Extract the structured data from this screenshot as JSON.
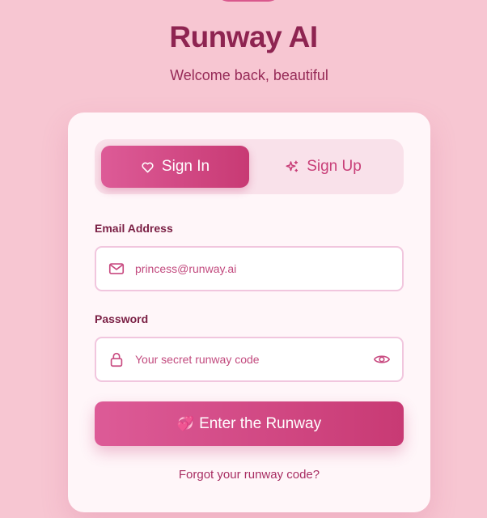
{
  "app": {
    "title": "Runway AI",
    "subtitle": "Welcome back, beautiful"
  },
  "tabs": [
    {
      "label": "Sign In",
      "icon": "heart-icon",
      "active": true
    },
    {
      "label": "Sign Up",
      "icon": "sparkle-icon",
      "active": false
    }
  ],
  "form": {
    "email": {
      "label": "Email Address",
      "placeholder": "princess@runway.ai",
      "value": "",
      "icon": "mail-icon"
    },
    "password": {
      "label": "Password",
      "placeholder": "Your secret runway code",
      "value": "",
      "icon": "lock-icon",
      "toggle_icon": "eye-icon"
    },
    "submit": {
      "emoji": "💞",
      "label": "Enter the Runway"
    },
    "forgot_link": "Forgot your runway code?"
  },
  "colors": {
    "background": "#f7c6d2",
    "accent_start": "#dd5b97",
    "accent_end": "#c83a74",
    "title": "#8e2451",
    "card": "#fff6f9"
  }
}
